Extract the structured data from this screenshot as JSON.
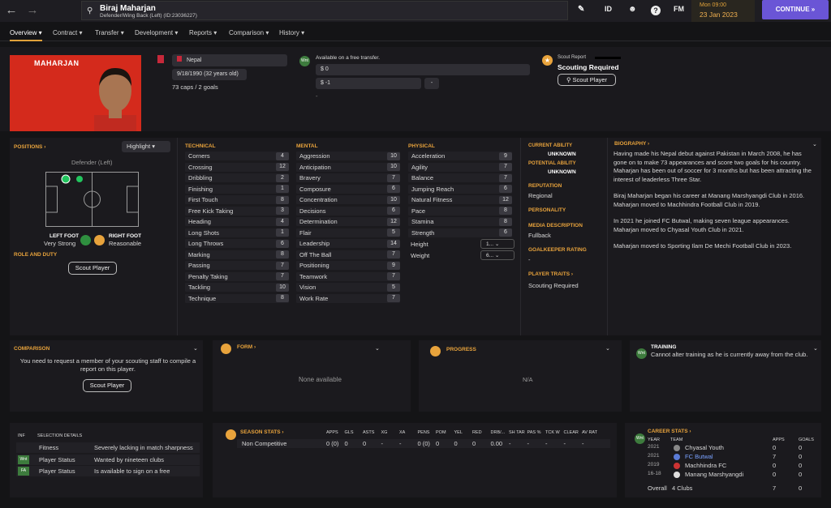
{
  "topbar": {
    "back_icon": "arrow-left-icon",
    "forward_icon": "arrow-right-icon",
    "player_name": "Biraj Maharjan",
    "player_sub": "Defender/Wing Back (Left) (ID:23036227)",
    "edit_icon": "pencil-icon",
    "id_label": "ID",
    "fm_label": "FM",
    "date_time": "Mon 09:00",
    "date": "23 Jan 2023",
    "continue_label": "CONTINUE"
  },
  "tabs": [
    {
      "label": "Overview"
    },
    {
      "label": "Contract"
    },
    {
      "label": "Transfer"
    },
    {
      "label": "Development"
    },
    {
      "label": "Reports"
    },
    {
      "label": "Comparison"
    },
    {
      "label": "History"
    }
  ],
  "profile": {
    "surname": "MAHARJAN",
    "nation": "Nepal",
    "dob": "9/18/1990 (32 years old)",
    "caps": "73 caps / 2 goals"
  },
  "transfer": {
    "status": "Available on a free transfer.",
    "value1": "$ 0",
    "value2": "$ -1",
    "dash_btn": "-",
    "note": "-"
  },
  "scout": {
    "label": "Scout Report",
    "status": "Scouting Required",
    "button": "Scout Player"
  },
  "positions": {
    "header": "POSITIONS",
    "highlight": "Highlight",
    "role": "Defender (Left)",
    "left_foot_label": "LEFT FOOT",
    "left_foot_val": "Very Strong",
    "right_foot_label": "RIGHT FOOT",
    "right_foot_val": "Reasonable",
    "role_duty": "ROLE AND DUTY",
    "scout_btn": "Scout Player"
  },
  "technical": {
    "header": "TECHNICAL",
    "rows": [
      {
        "name": "Corners",
        "value": "4"
      },
      {
        "name": "Crossing",
        "value": "12"
      },
      {
        "name": "Dribbling",
        "value": "2"
      },
      {
        "name": "Finishing",
        "value": "1"
      },
      {
        "name": "First Touch",
        "value": "8"
      },
      {
        "name": "Free Kick Taking",
        "value": "3"
      },
      {
        "name": "Heading",
        "value": "4"
      },
      {
        "name": "Long Shots",
        "value": "1"
      },
      {
        "name": "Long Throws",
        "value": "6"
      },
      {
        "name": "Marking",
        "value": "8"
      },
      {
        "name": "Passing",
        "value": "7"
      },
      {
        "name": "Penalty Taking",
        "value": "7"
      },
      {
        "name": "Tackling",
        "value": "10"
      },
      {
        "name": "Technique",
        "value": "8"
      }
    ]
  },
  "mental": {
    "header": "MENTAL",
    "rows": [
      {
        "name": "Aggression",
        "value": "10"
      },
      {
        "name": "Anticipation",
        "value": "10"
      },
      {
        "name": "Bravery",
        "value": "7"
      },
      {
        "name": "Composure",
        "value": "6"
      },
      {
        "name": "Concentration",
        "value": "10"
      },
      {
        "name": "Decisions",
        "value": "6"
      },
      {
        "name": "Determination",
        "value": "12"
      },
      {
        "name": "Flair",
        "value": "5"
      },
      {
        "name": "Leadership",
        "value": "14"
      },
      {
        "name": "Off The Ball",
        "value": "7"
      },
      {
        "name": "Positioning",
        "value": "9"
      },
      {
        "name": "Teamwork",
        "value": "7"
      },
      {
        "name": "Vision",
        "value": "5"
      },
      {
        "name": "Work Rate",
        "value": "7"
      }
    ]
  },
  "physical": {
    "header": "PHYSICAL",
    "rows": [
      {
        "name": "Acceleration",
        "value": "9"
      },
      {
        "name": "Agility",
        "value": "7"
      },
      {
        "name": "Balance",
        "value": "7"
      },
      {
        "name": "Jumping Reach",
        "value": "6"
      },
      {
        "name": "Natural Fitness",
        "value": "12"
      },
      {
        "name": "Pace",
        "value": "8"
      },
      {
        "name": "Stamina",
        "value": "8"
      },
      {
        "name": "Strength",
        "value": "6"
      }
    ],
    "height_label": "Height",
    "height_val": "1...",
    "weight_label": "Weight",
    "weight_val": "6..."
  },
  "ability": {
    "current_label": "CURRENT ABILITY",
    "current_val": "UNKNOWN",
    "potential_label": "POTENTIAL ABILITY",
    "potential_val": "UNKNOWN",
    "reputation_label": "REPUTATION",
    "reputation_val": "Regional",
    "personality_label": "PERSONALITY",
    "media_label": "MEDIA DESCRIPTION",
    "media_val": "Fullback",
    "gk_label": "GOALKEEPER RATING",
    "gk_val": "-",
    "traits_label": "PLAYER TRAITS",
    "traits_val": "Scouting Required"
  },
  "biography": {
    "header": "BIOGRAPHY",
    "p1": "Having made his Nepal debut against Pakistan in March 2008, he has gone on to make 73 appearances and score two goals for his country. Maharjan has been out of soccer for 3 months but has been attracting the interest of leaderless Three Star.",
    "p2": "Biraj Maharjan began his career at Manang Marshyangdi Club in 2016. Maharjan moved to Machhindra Football Club in 2019.",
    "p3": "In 2021 he joined FC Butwal, making seven league appearances. Maharjan moved to Chyasal Youth Club in 2021.",
    "p4": "Maharjan moved to Sporting Ilam De Mechi Football Club in 2023."
  },
  "comparison": {
    "header": "COMPARISON",
    "text": "You need to request a member of your scouting staff to compile a report on this player.",
    "button": "Scout Player"
  },
  "form": {
    "header": "FORM",
    "text": "None available"
  },
  "progress": {
    "header": "PROGRESS",
    "text": "N/A"
  },
  "training": {
    "header": "TRAINING",
    "text": "Cannot alter training as he is currently away from the club."
  },
  "selection": {
    "col1": "INF",
    "col2": "SELECTION DETAILS",
    "rows": [
      {
        "badge": "",
        "label": "Fitness",
        "value": "Severely lacking in match sharpness"
      },
      {
        "badge": "Wnt",
        "label": "Player Status",
        "value": "Wanted by nineteen clubs"
      },
      {
        "badge": "FA",
        "label": "Player Status",
        "value": "Is available to sign on a free"
      }
    ]
  },
  "season_stats": {
    "header": "SEASON STATS",
    "columns": [
      "APPS",
      "GLS",
      "ASTS",
      "XG",
      "XA",
      "PENS",
      "POM",
      "YEL",
      "RED",
      "DRB/...",
      "SH TAR",
      "PAS %",
      "TCK W",
      "CLEAR",
      "AV RAT"
    ],
    "row_label": "Non Competitive",
    "row": [
      "0 (0)",
      "0",
      "0",
      "-",
      "-",
      "0 (0)",
      "0",
      "0",
      "0",
      "0.00",
      "-",
      "-",
      "-",
      "-",
      "-"
    ]
  },
  "career_stats": {
    "header": "CAREER STATS",
    "col_year": "YEAR",
    "col_team": "TEAM",
    "col_apps": "APPS",
    "col_goals": "GOALS",
    "rows": [
      {
        "year": "2021",
        "team": "Chyasal Youth",
        "apps": "0",
        "goals": "0"
      },
      {
        "year": "2021",
        "team": "FC Butwal",
        "apps": "7",
        "goals": "0"
      },
      {
        "year": "2019",
        "team": "Machhindra FC",
        "apps": "0",
        "goals": "0"
      },
      {
        "year": "16-18",
        "team": "Manang Marshyangdi",
        "apps": "0",
        "goals": "0"
      }
    ],
    "overall_label": "Overall",
    "overall_clubs": "4 Clubs",
    "overall_apps": "7",
    "overall_goals": "0"
  },
  "colors": {
    "accent": "#e8a33c",
    "continue": "#6a55d6",
    "background": "#141416",
    "panel": "#1b1a1e"
  }
}
